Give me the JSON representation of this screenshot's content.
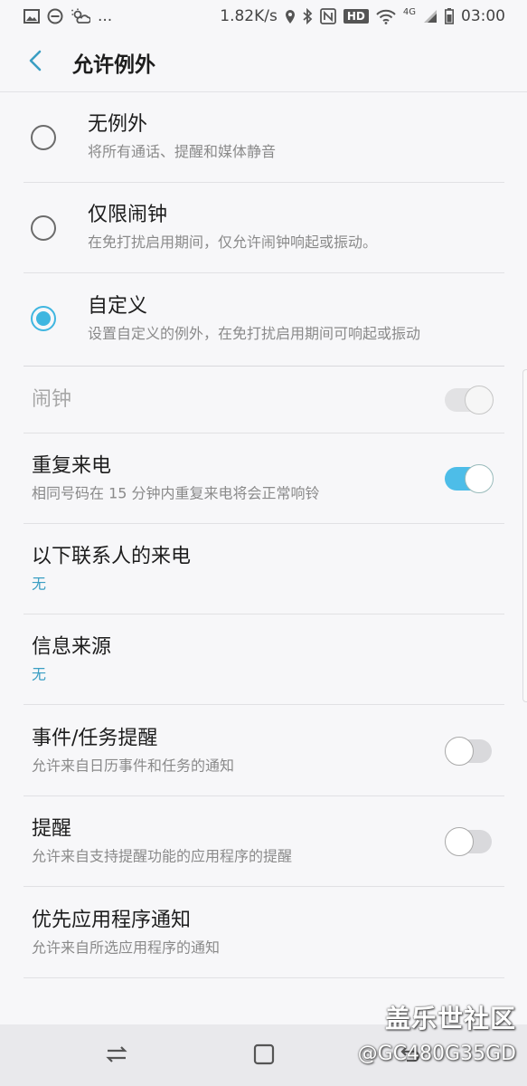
{
  "status_bar": {
    "left_icons": [
      "image-icon",
      "dnd-icon",
      "weather-icon"
    ],
    "more": "...",
    "speed": "1.82K/s",
    "hd_badge": "HD",
    "network": "4G",
    "time": "03:00"
  },
  "app_bar": {
    "title": "允许例外"
  },
  "radio_options": [
    {
      "title": "无例外",
      "subtitle": "将所有通话、提醒和媒体静音",
      "checked": false
    },
    {
      "title": "仅限闹钟",
      "subtitle": "在免打扰启用期间，仅允许闹钟响起或振动。",
      "checked": false
    },
    {
      "title": "自定义",
      "subtitle": "设置自定义的例外，在免打扰启用期间可响起或振动",
      "checked": true
    }
  ],
  "settings": {
    "alarm": {
      "title": "闹钟",
      "state": "on",
      "enabled": false
    },
    "repeat_callers": {
      "title": "重复来电",
      "subtitle": "相同号码在 15 分钟内重复来电将会正常响铃",
      "state": "on"
    },
    "calls_from": {
      "title": "以下联系人的来电",
      "value": "无"
    },
    "messages_from": {
      "title": "信息来源",
      "value": "无"
    },
    "events_tasks": {
      "title": "事件/任务提醒",
      "subtitle": "允许来自日历事件和任务的通知",
      "state": "off"
    },
    "reminders": {
      "title": "提醒",
      "subtitle": "允许来自支持提醒功能的应用程序的提醒",
      "state": "off"
    },
    "priority_apps": {
      "title": "优先应用程序通知",
      "subtitle": "允许来自所选应用程序的通知"
    }
  },
  "watermark": {
    "line1": "盖乐世社区",
    "line2": "@GC480G35GD"
  },
  "colors": {
    "accent": "#3fb6e0",
    "value_text": "#3a9ec3",
    "background": "#f7f7f9"
  }
}
